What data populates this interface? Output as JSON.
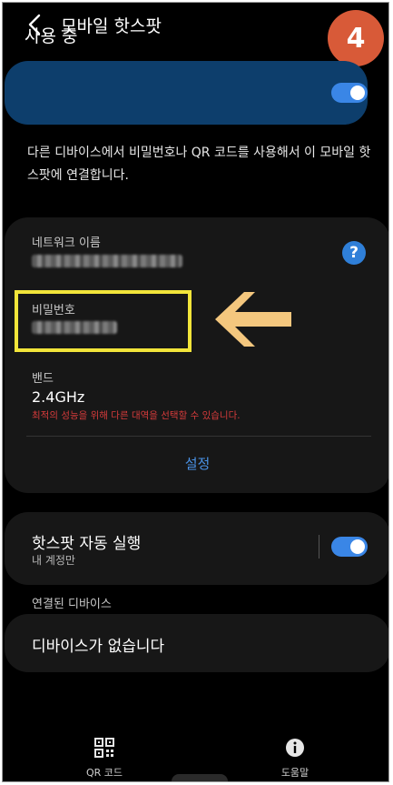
{
  "header": {
    "back_icon": "chevron-left-icon",
    "title": "모바일 핫스팟",
    "step_badge": "4"
  },
  "in_use": {
    "label": "사용 중",
    "toggle_on": true
  },
  "description": "다른 디바이스에서 비밀번호나 QR 코드를 사용해서 이 모바일 핫스팟에 연결합니다.",
  "network": {
    "name_label": "네트워크 이름",
    "password_label": "비밀번호",
    "band_label": "밴드",
    "band_value": "2.4GHz",
    "band_note": "최적의 성능을 위해 다른 대역을 선택할 수 있습니다.",
    "settings_link": "설정",
    "help_icon_glyph": "?"
  },
  "auto_hotspot": {
    "title": "핫스팟 자동 실행",
    "subtitle": "내 계정만",
    "toggle_on": true
  },
  "connected_devices": {
    "section_label": "연결된 디바이스",
    "empty_text": "디바이스가 없습니다"
  },
  "bottom_bar": {
    "qr_label": "QR 코드",
    "help_label": "도움말"
  },
  "colors": {
    "accent": "#3a86e6",
    "highlight": "#f2e53a",
    "arrow": "#f4c77e",
    "warning_text": "#d63b3b",
    "badge": "#d85a38"
  }
}
